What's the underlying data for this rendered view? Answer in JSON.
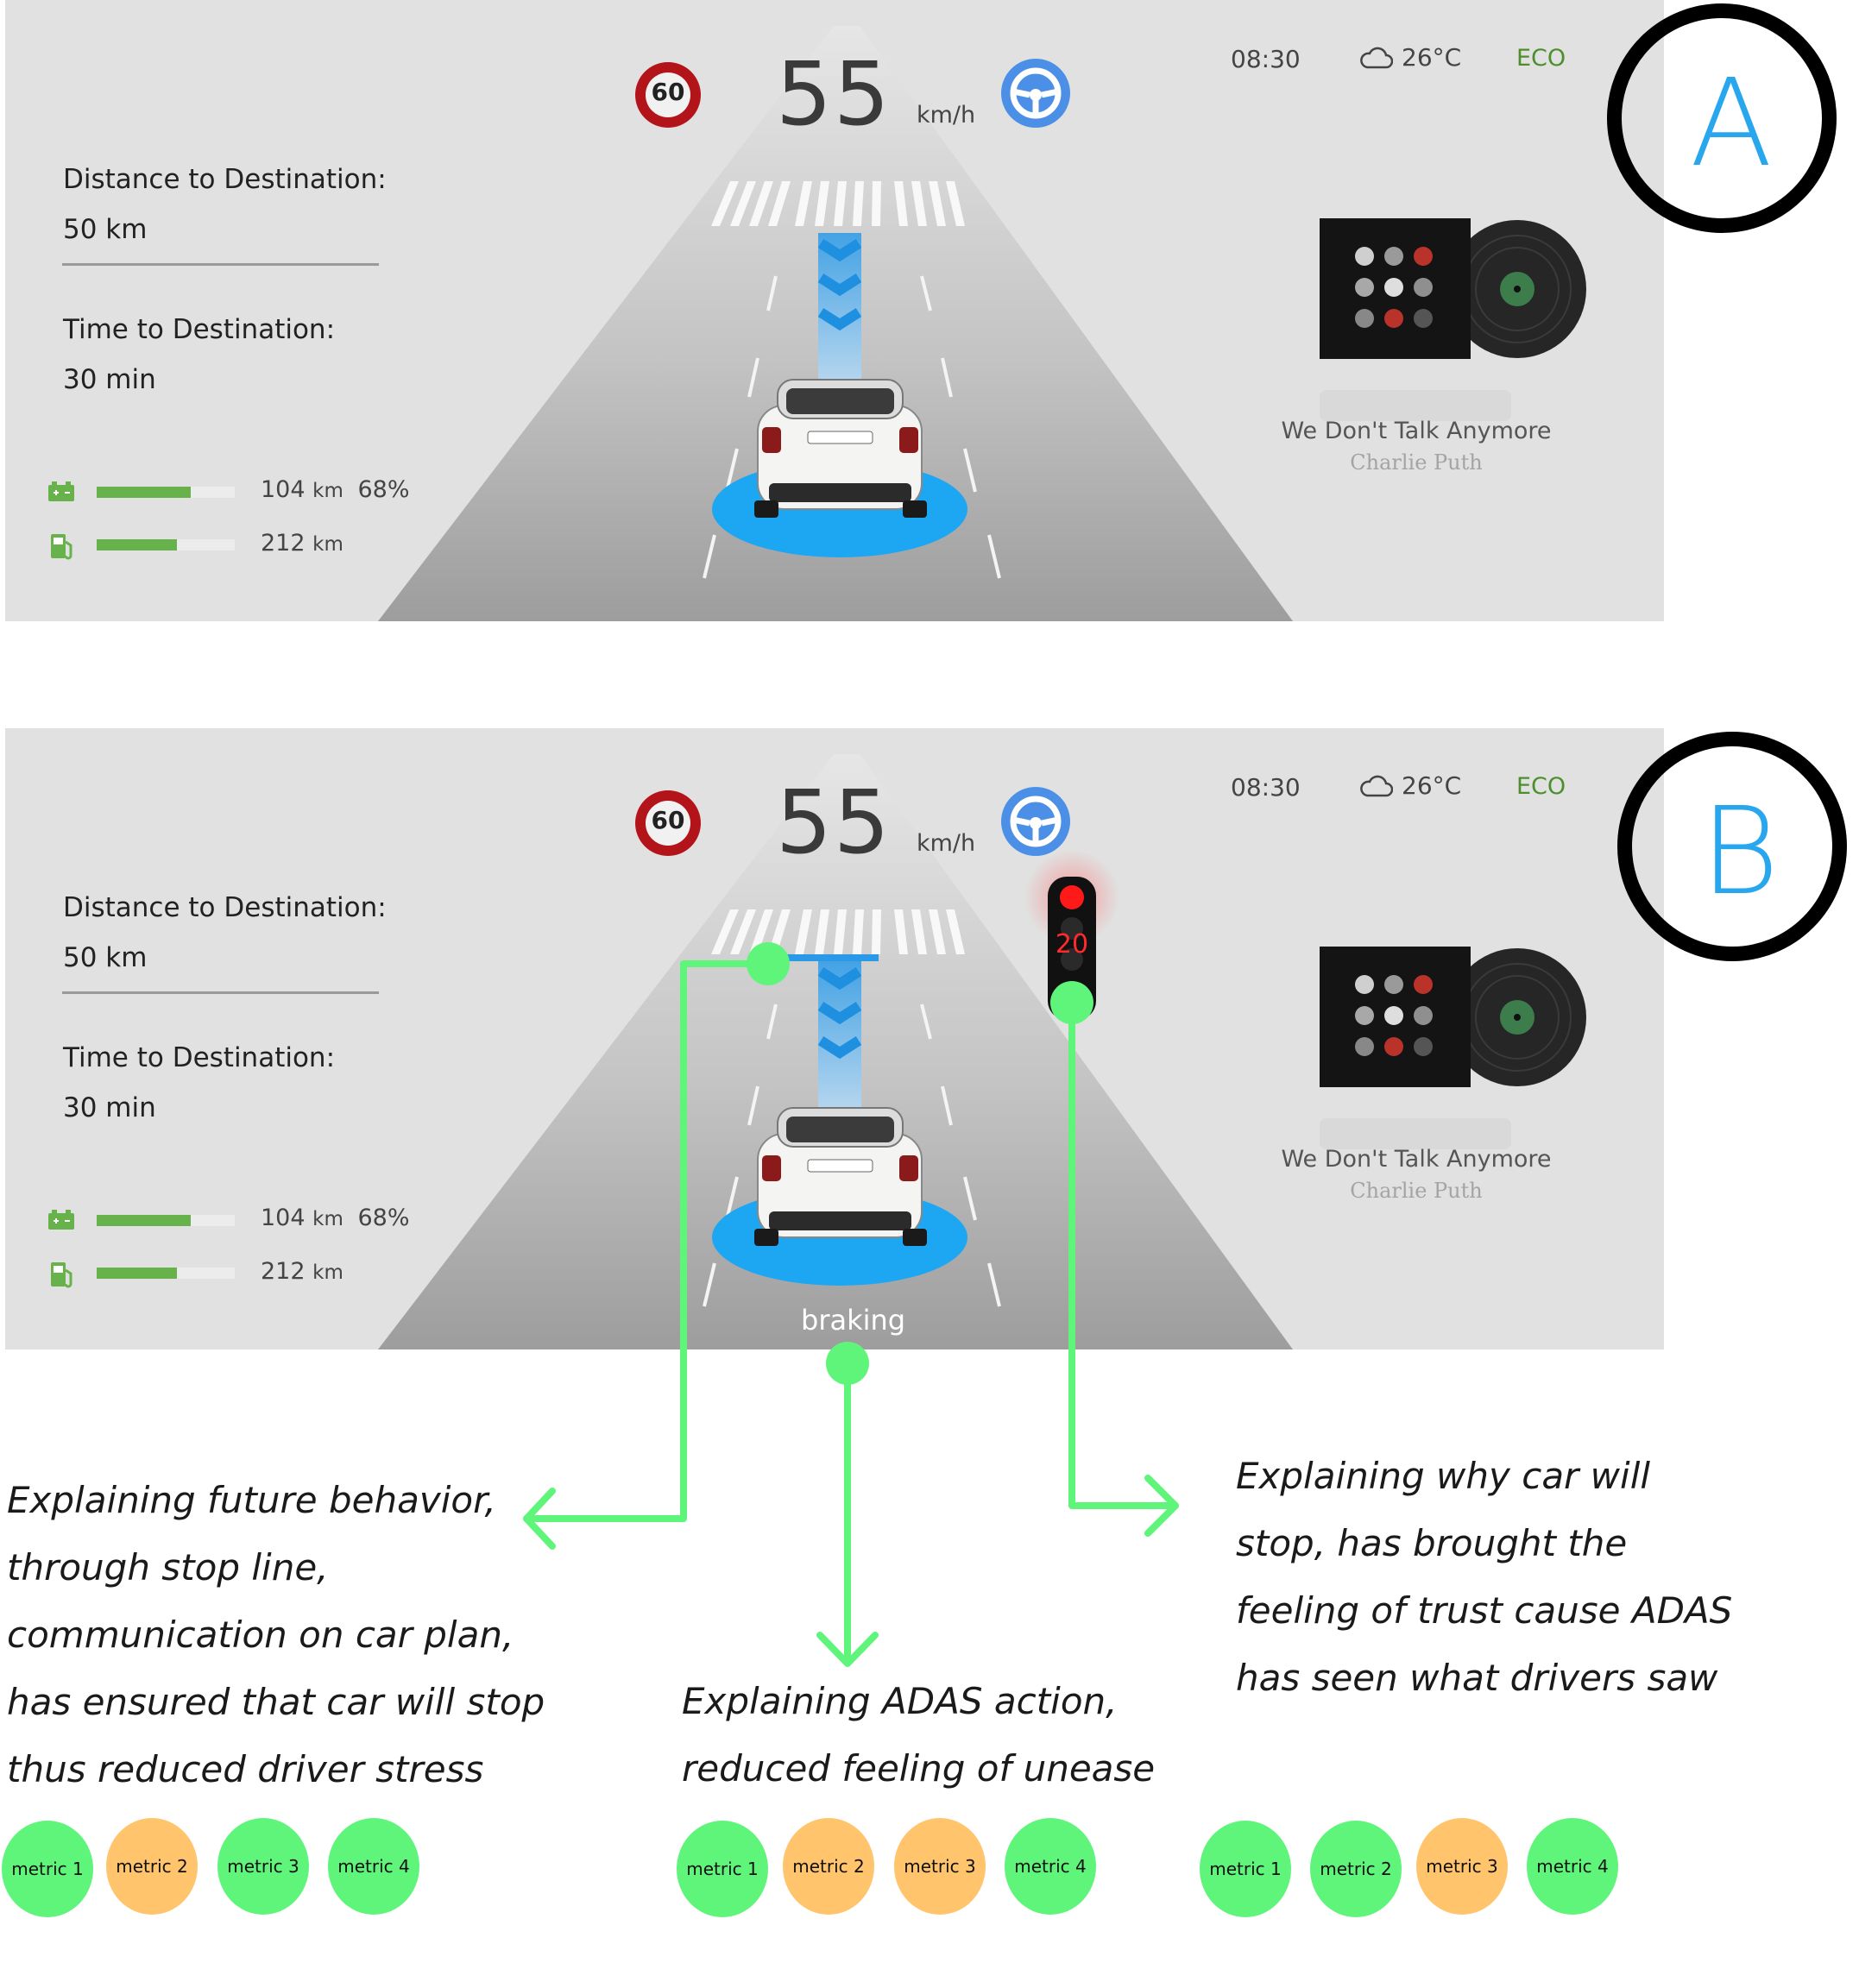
{
  "colors": {
    "panel_bg": "#e1e1e1",
    "accent_blue": "#29a7ee",
    "bar_green": "#67b24a",
    "annotation_green": "#5ff57b",
    "metric_orange": "#ffc46c",
    "eco_green": "#4d8f2c",
    "traffic_red": "#ff1a1a"
  },
  "panels": [
    {
      "label": "A",
      "speed_limit": "60",
      "speed": "55",
      "speed_unit": "km/h",
      "time": "08:30",
      "temperature": "26°C",
      "mode": "ECO",
      "distance_label": "Distance to Destination:",
      "distance_value": "50 km",
      "time_label": "Time to Destination:",
      "time_value": "30 min",
      "battery_range": "104",
      "battery_unit": "km",
      "battery_percent": "68%",
      "battery_level": 0.68,
      "fuel_range": "212",
      "fuel_unit": "km",
      "fuel_level": 0.58,
      "song": "We Don't Talk Anymore",
      "artist": "Charlie Puth"
    },
    {
      "label": "B",
      "speed_limit": "60",
      "speed": "55",
      "speed_unit": "km/h",
      "time": "08:30",
      "temperature": "26°C",
      "mode": "ECO",
      "distance_label": "Distance to Destination:",
      "distance_value": "50 km",
      "time_label": "Time to Destination:",
      "time_value": "30 min",
      "battery_range": "104",
      "battery_unit": "km",
      "battery_percent": "68%",
      "battery_level": 0.68,
      "fuel_range": "212",
      "fuel_unit": "km",
      "fuel_level": 0.58,
      "song": "We Don't Talk Anymore",
      "artist": "Charlie Puth",
      "traffic_light_countdown": "20",
      "status_text": "braking"
    }
  ],
  "annotations": [
    {
      "lines": [
        "Explaining future behavior,",
        "through stop line,",
        "communication on car plan,",
        "has ensured that car will stop",
        "thus reduced driver stress"
      ],
      "metrics": [
        {
          "label": "metric 1",
          "color": "green"
        },
        {
          "label": "metric 2",
          "color": "orange"
        },
        {
          "label": "metric 3",
          "color": "green"
        },
        {
          "label": "metric 4",
          "color": "green"
        }
      ]
    },
    {
      "lines": [
        "Explaining ADAS action,",
        "reduced feeling of unease"
      ],
      "metrics": [
        {
          "label": "metric 1",
          "color": "green"
        },
        {
          "label": "metric 2",
          "color": "orange"
        },
        {
          "label": "metric 3",
          "color": "orange"
        },
        {
          "label": "metric 4",
          "color": "green"
        }
      ]
    },
    {
      "lines": [
        "Explaining why car will",
        "stop, has brought the",
        "feeling of trust cause ADAS",
        "has seen what drivers saw"
      ],
      "metrics": [
        {
          "label": "metric 1",
          "color": "green"
        },
        {
          "label": "metric 2",
          "color": "green"
        },
        {
          "label": "metric 3",
          "color": "orange"
        },
        {
          "label": "metric 4",
          "color": "green"
        }
      ]
    }
  ]
}
